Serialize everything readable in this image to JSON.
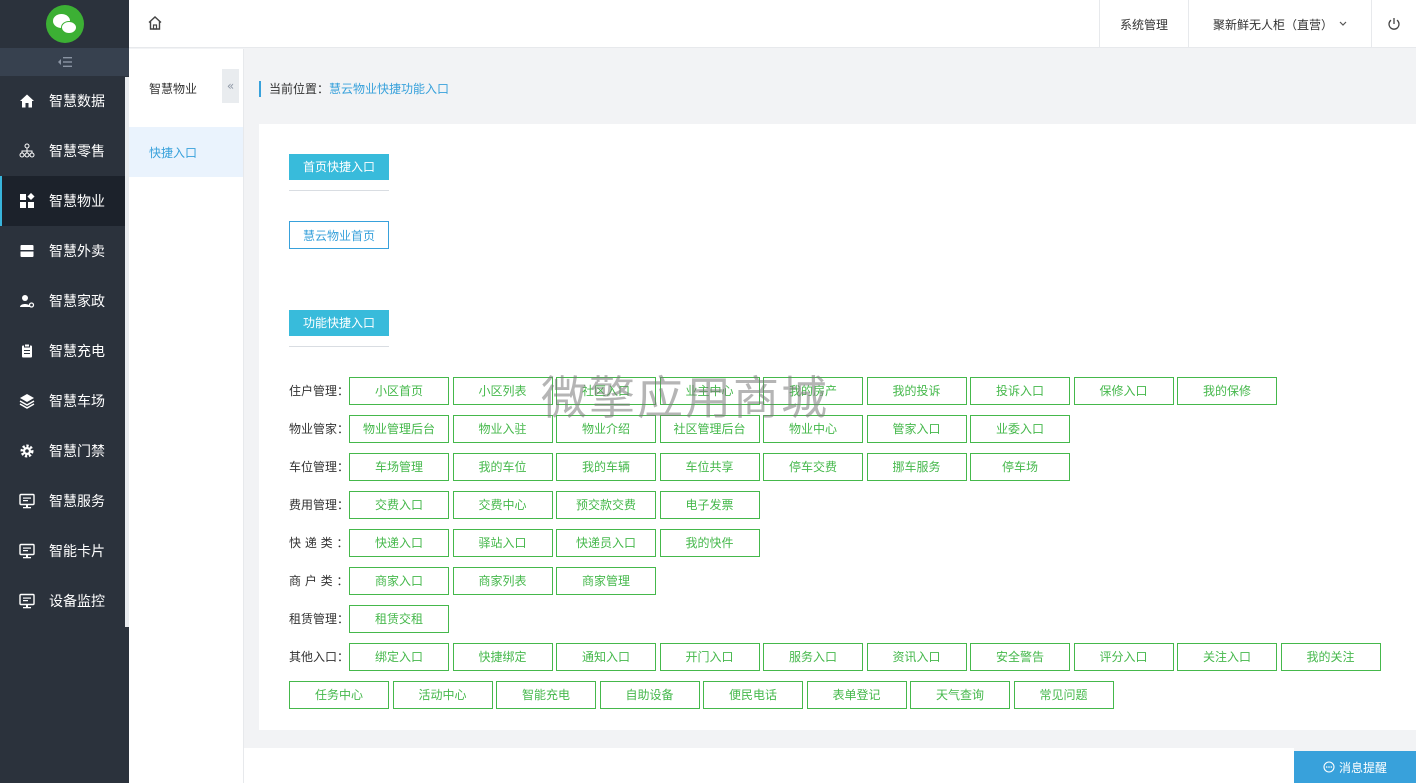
{
  "sidebar": {
    "collapse_icon": "menu-collapse-icon",
    "items": [
      {
        "label": "智慧数据",
        "icon": "home-icon"
      },
      {
        "label": "智慧零售",
        "icon": "org-chart-icon"
      },
      {
        "label": "智慧物业",
        "icon": "grid-icon"
      },
      {
        "label": "智慧外卖",
        "icon": "inbox-icon"
      },
      {
        "label": "智慧家政",
        "icon": "user-gear-icon"
      },
      {
        "label": "智慧充电",
        "icon": "clipboard-icon"
      },
      {
        "label": "智慧车场",
        "icon": "layers-icon"
      },
      {
        "label": "智慧门禁",
        "icon": "gear-icon"
      },
      {
        "label": "智慧服务",
        "icon": "monitor-icon"
      },
      {
        "label": "智能卡片",
        "icon": "monitor-icon"
      },
      {
        "label": "设备监控",
        "icon": "monitor-icon"
      }
    ],
    "active_index": 2
  },
  "header": {
    "system": "系统管理",
    "user": "聚新鲜无人柜（直营）",
    "power_icon": "power-icon",
    "home_icon": "home-outline-icon"
  },
  "submenu": {
    "title": "智慧物业",
    "collapse": "«",
    "item": "快捷入口"
  },
  "breadcrumb": {
    "prefix": "当前位置：",
    "current": "慧云物业快捷功能入口"
  },
  "sections": {
    "home_title": "首页快捷入口",
    "home_link": "慧云物业首页",
    "func_title": "功能快捷入口"
  },
  "rows": [
    {
      "label": "住户管理：",
      "buttons": [
        "小区首页",
        "小区列表",
        "社区入口",
        "业主中心",
        "我的房产",
        "我的投诉",
        "投诉入口",
        "保修入口",
        "我的保修"
      ]
    },
    {
      "label": "物业管家：",
      "buttons": [
        "物业管理后台",
        "物业入驻",
        "物业介绍",
        "社区管理后台",
        "物业中心",
        "管家入口",
        "业委入口"
      ]
    },
    {
      "label": "车位管理：",
      "buttons": [
        "车场管理",
        "我的车位",
        "我的车辆",
        "车位共享",
        "停车交费",
        "挪车服务",
        "停车场"
      ]
    },
    {
      "label": "费用管理：",
      "buttons": [
        "交费入口",
        "交费中心",
        "预交款交费",
        "电子发票"
      ]
    },
    {
      "label": "快 递 类 ：",
      "buttons": [
        "快递入口",
        "驿站入口",
        "快递员入口",
        "我的快件"
      ]
    },
    {
      "label": "商 户 类 ：",
      "buttons": [
        "商家入口",
        "商家列表",
        "商家管理"
      ]
    },
    {
      "label": "租赁管理：",
      "buttons": [
        "租赁交租"
      ]
    },
    {
      "label": "其他入口：",
      "buttons": [
        "绑定入口",
        "快捷绑定",
        "通知入口",
        "开门入口",
        "服务入口",
        "资讯入口",
        "安全警告",
        "评分入口",
        "关注入口",
        "我的关注"
      ]
    },
    {
      "label": "",
      "buttons": [
        "任务中心",
        "活动中心",
        "智能充电",
        "自助设备",
        "便民电话",
        "表单登记",
        "天气查询",
        "常见问题"
      ]
    }
  ],
  "watermark": "微擎应用商城",
  "notify": {
    "label": "消息提醒",
    "icon": "chat-icon"
  },
  "colors": {
    "sidebar_bg": "#2b323c",
    "accent_blue": "#38a1db",
    "section_title_bg": "#38bbdb",
    "button_green": "#45b84b"
  }
}
